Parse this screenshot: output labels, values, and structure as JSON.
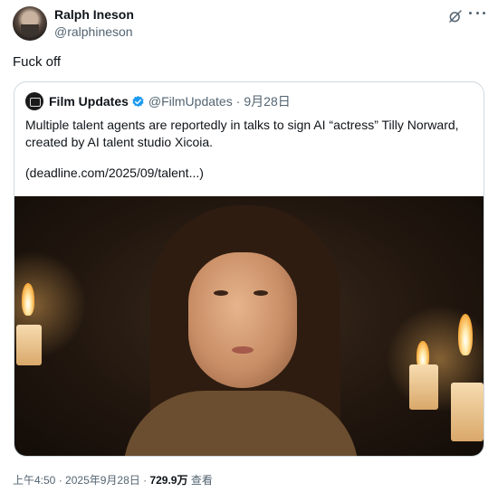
{
  "author": {
    "display_name": "Ralph Ineson",
    "handle": "@ralphineson"
  },
  "tweet": {
    "text": "Fuck off"
  },
  "quoted": {
    "display_name": "Film Updates",
    "handle": "@FilmUpdates",
    "separator": "·",
    "date": "9月28日",
    "body": "Multiple talent agents are reportedly in talks to sign AI “actress” Tilly Norward, created by AI talent studio Xicoia.",
    "link": "(deadline.com/2025/09/talent...)"
  },
  "meta": {
    "time": "上午4:50",
    "separator": "·",
    "date": "2025年9月28日",
    "separator2": "·",
    "views_count": "729.9万",
    "views_label": "查看"
  },
  "colors": {
    "text": "#0f1419",
    "secondary": "#536471",
    "border": "#cfd9de",
    "verified": "#1d9bf0"
  },
  "icons": [
    "grok-icon",
    "more-icon",
    "verified-badge-icon"
  ]
}
